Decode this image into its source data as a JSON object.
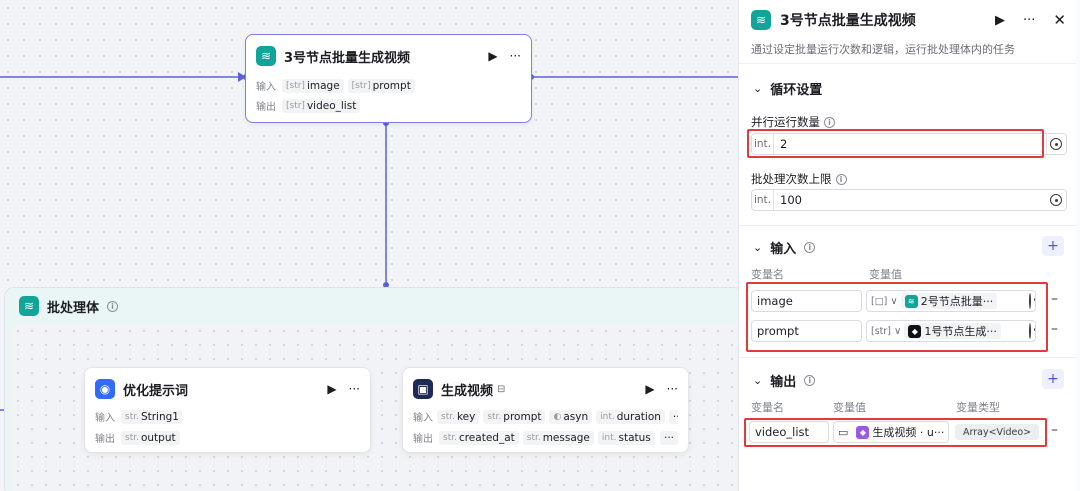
{
  "top_node": {
    "title": "3号节点批量生成视频",
    "input_label": "输入",
    "output_label": "输出",
    "inputs": [
      {
        "type": "[str]",
        "name": "image"
      },
      {
        "type": "[str]",
        "name": "prompt"
      }
    ],
    "outputs": [
      {
        "type": "[str]",
        "name": "video_list"
      }
    ]
  },
  "group": {
    "title": "批处理体"
  },
  "node_optimize": {
    "title": "优化提示词",
    "input_label": "输入",
    "output_label": "输出",
    "inputs": [
      {
        "type": "str.",
        "name": "String1"
      }
    ],
    "outputs": [
      {
        "type": "str.",
        "name": "output"
      }
    ]
  },
  "node_video": {
    "title": "生成视频",
    "input_label": "输入",
    "output_label": "输出",
    "inputs": [
      {
        "type": "str.",
        "name": "key"
      },
      {
        "type": "str.",
        "name": "prompt"
      },
      {
        "type": "",
        "name": "asyn"
      },
      {
        "type": "int.",
        "name": "duration"
      }
    ],
    "outputs": [
      {
        "type": "str.",
        "name": "created_at"
      },
      {
        "type": "str.",
        "name": "message"
      },
      {
        "type": "int.",
        "name": "status"
      }
    ],
    "more": "···"
  },
  "panel": {
    "title": "3号节点批量生成视频",
    "description": "通过设定批量运行次数和逻辑，运行批处理体内的任务",
    "loop_section": "循环设置",
    "parallel_label": "并行运行数量",
    "parallel_type": "int.",
    "parallel_value": "2",
    "batch_label": "批处理次数上限",
    "batch_type": "int.",
    "batch_value": "100",
    "input_section": "输入",
    "var_name_header": "变量名",
    "var_value_header": "变量值",
    "inputs": [
      {
        "name": "image",
        "type": "[□]",
        "ref": "2号节点批量···"
      },
      {
        "name": "prompt",
        "type": "[str]",
        "ref": "1号节点生成···"
      }
    ],
    "output_section": "输出",
    "var_type_header": "变量类型",
    "outputs": [
      {
        "name": "video_list",
        "ref": "生成视频 · u···",
        "vtype": "Array<Video>"
      }
    ]
  },
  "colors": {
    "accent": "#4d53e8",
    "highlight": "#e3393c",
    "teal": "#11a59a",
    "wire": "#5b5fe0"
  }
}
